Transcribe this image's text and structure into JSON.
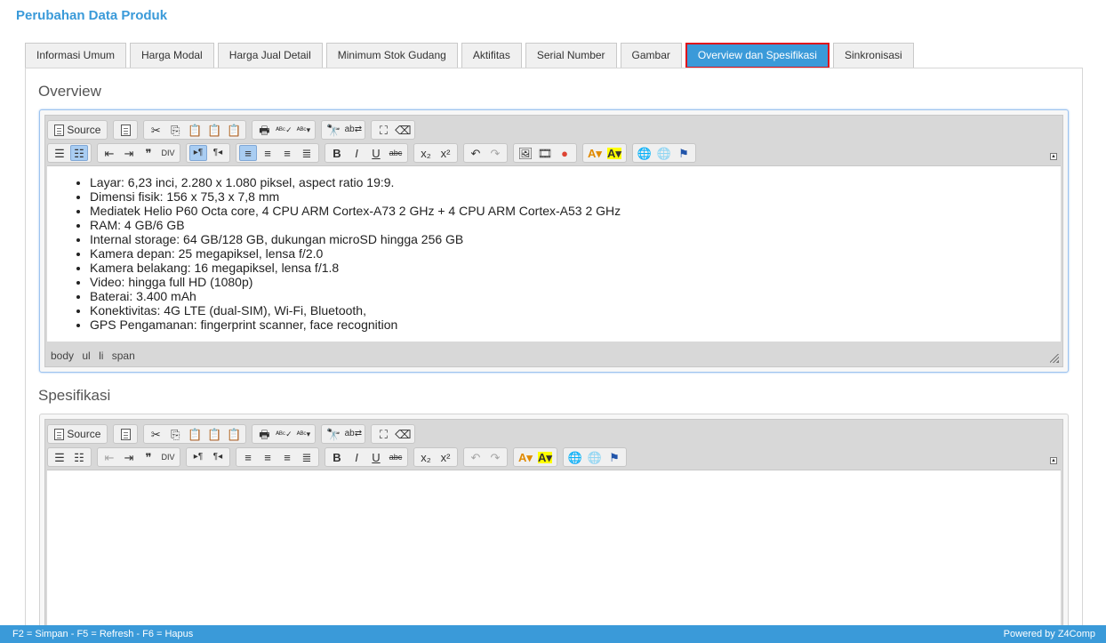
{
  "page": {
    "title": "Perubahan Data Produk"
  },
  "tabs": [
    {
      "label": "Informasi Umum"
    },
    {
      "label": "Harga Modal"
    },
    {
      "label": "Harga Jual Detail"
    },
    {
      "label": "Minimum Stok Gudang"
    },
    {
      "label": "Aktifitas"
    },
    {
      "label": "Serial Number"
    },
    {
      "label": "Gambar"
    },
    {
      "label": "Overview dan Spesifikasi",
      "active": true
    },
    {
      "label": "Sinkronisasi"
    }
  ],
  "overview": {
    "title": "Overview",
    "toolbar": {
      "source_label": "Source"
    },
    "items": [
      "Layar: 6,23 inci, 2.280 x 1.080 piksel, aspect ratio 19:9.",
      "Dimensi fisik: 156 x 75,3 x 7,8 mm",
      "Mediatek Helio P60 Octa core, 4 CPU ARM Cortex-A73 2 GHz + 4 CPU ARM Cortex-A53 2 GHz",
      "RAM: 4 GB/6 GB",
      "Internal storage: 64 GB/128 GB, dukungan microSD hingga 256 GB",
      "Kamera depan: 25 megapiksel, lensa f/2.0",
      "Kamera belakang: 16 megapiksel, lensa f/1.8",
      "Video: hingga full HD (1080p)",
      "Baterai: 3.400 mAh",
      "Konektivitas:  4G LTE (dual-SIM), Wi-Fi, Bluetooth,",
      "GPS Pengamanan: fingerprint scanner, face recognition"
    ],
    "path": [
      "body",
      "ul",
      "li",
      "span"
    ]
  },
  "spesifikasi": {
    "title": "Spesifikasi",
    "toolbar": {
      "source_label": "Source"
    }
  },
  "footer": {
    "shortcuts": "F2 = Simpan - F5 = Refresh - F6 = Hapus",
    "powered": "Powered by Z4Comp"
  },
  "colors": {
    "accent": "#3a9ad9",
    "active_tab_border": "#e0101b"
  }
}
